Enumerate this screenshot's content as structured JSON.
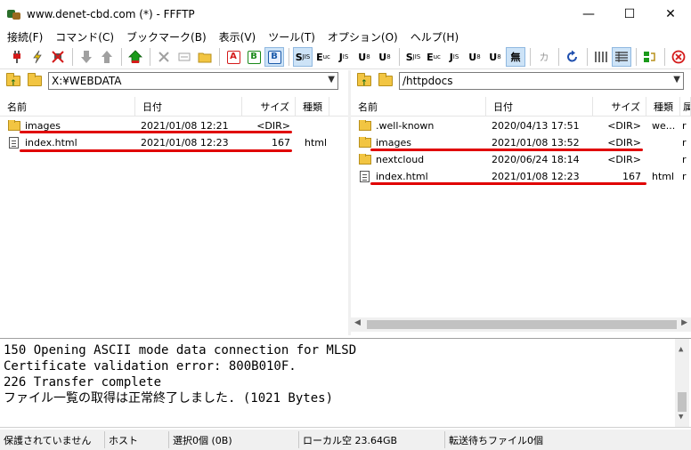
{
  "window": {
    "title": "www.denet-cbd.com (*) - FFFTP",
    "minimize": "—",
    "maximize": "☐",
    "close": "✕"
  },
  "menu": [
    "接続(F)",
    "コマンド(C)",
    "ブックマーク(B)",
    "表示(V)",
    "ツール(T)",
    "オプション(O)",
    "ヘルプ(H)"
  ],
  "toolbar": {
    "ascii_label": "A",
    "binary_label": "B",
    "auto_label": "B",
    "codes": [
      "S",
      "E",
      "J",
      "U",
      "U"
    ],
    "codes2": [
      "S",
      "E",
      "J",
      "U",
      "U"
    ],
    "none_label": "無",
    "kana_label": "カ"
  },
  "local": {
    "path": "X:¥WEBDATA",
    "columns": {
      "name": "名前",
      "date": "日付",
      "size": "サイズ",
      "type": "種類"
    },
    "files": [
      {
        "name": "images",
        "date": "2021/01/08 12:21",
        "size": "<DIR>",
        "type": "",
        "kind": "folder"
      },
      {
        "name": "index.html",
        "date": "2021/01/08 12:23",
        "size": "167",
        "type": "html",
        "kind": "file"
      }
    ]
  },
  "remote": {
    "path": "/httpdocs",
    "columns": {
      "name": "名前",
      "date": "日付",
      "size": "サイズ",
      "type": "種類",
      "attr": "属"
    },
    "files": [
      {
        "name": ".well-known",
        "date": "2020/04/13 17:51",
        "size": "<DIR>",
        "type": "we...",
        "attr": "r",
        "kind": "folder"
      },
      {
        "name": "images",
        "date": "2021/01/08 13:52",
        "size": "<DIR>",
        "type": "",
        "attr": "r",
        "kind": "folder"
      },
      {
        "name": "nextcloud",
        "date": "2020/06/24 18:14",
        "size": "<DIR>",
        "type": "",
        "attr": "r",
        "kind": "folder"
      },
      {
        "name": "index.html",
        "date": "2021/01/08 12:23",
        "size": "167",
        "type": "html",
        "attr": "r",
        "kind": "file"
      }
    ]
  },
  "log": [
    "150 Opening ASCII mode data connection for MLSD",
    "Certificate validation error: 800B010F.",
    "226 Transfer complete",
    "ファイル一覧の取得は正常終了しました. (1021 Bytes)"
  ],
  "status": {
    "security": "保護されていません",
    "host": "ホスト",
    "selection": "選択0個 (0B)",
    "local_free": "ローカル空 23.64GB",
    "queue": "転送待ちファイル0個"
  },
  "colors": {
    "highlight_underline": "#e00000",
    "folder": "#f2c542"
  }
}
